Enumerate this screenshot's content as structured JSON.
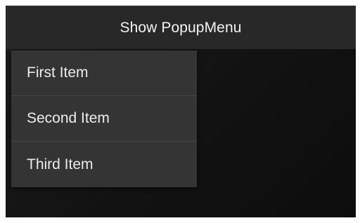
{
  "action_bar": {
    "button_label": "Show PopupMenu"
  },
  "popup_menu": {
    "items": [
      {
        "label": "First Item"
      },
      {
        "label": "Second Item"
      },
      {
        "label": "Third Item"
      }
    ]
  }
}
